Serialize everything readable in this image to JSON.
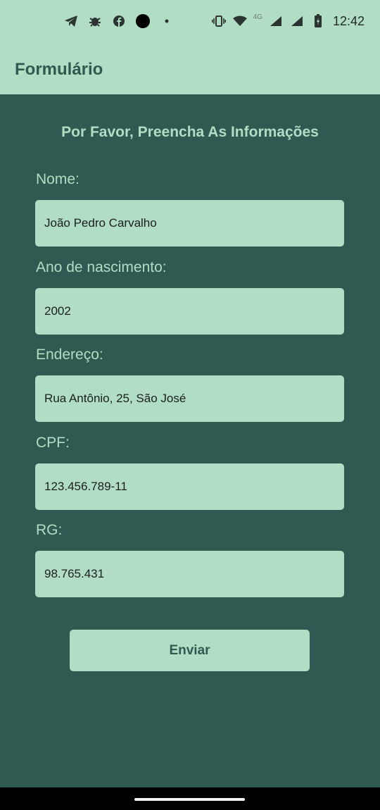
{
  "status_bar": {
    "time": "12:42",
    "network_label": "4G",
    "icons_left": [
      "telegram-icon",
      "bug-icon",
      "facebook-icon",
      "camera-dot-icon",
      "small-dot-icon"
    ],
    "icons_right": [
      "vibrate-icon",
      "wifi-icon",
      "signal-icon",
      "signal-icon",
      "battery-icon"
    ]
  },
  "app_bar": {
    "title": "Formulário"
  },
  "form": {
    "heading": "Por Favor, Preencha As Informações",
    "fields": [
      {
        "label": "Nome:",
        "value": "João Pedro Carvalho"
      },
      {
        "label": "Ano de nascimento:",
        "value": "2002"
      },
      {
        "label": "Endereço:",
        "value": "Rua Antônio, 25, São José"
      },
      {
        "label": "CPF:",
        "value": "123.456.789-11"
      },
      {
        "label": "RG:",
        "value": "98.765.431"
      }
    ],
    "submit_label": "Enviar"
  },
  "colors": {
    "background": "#2e5a51",
    "accent": "#b0ddc3"
  }
}
